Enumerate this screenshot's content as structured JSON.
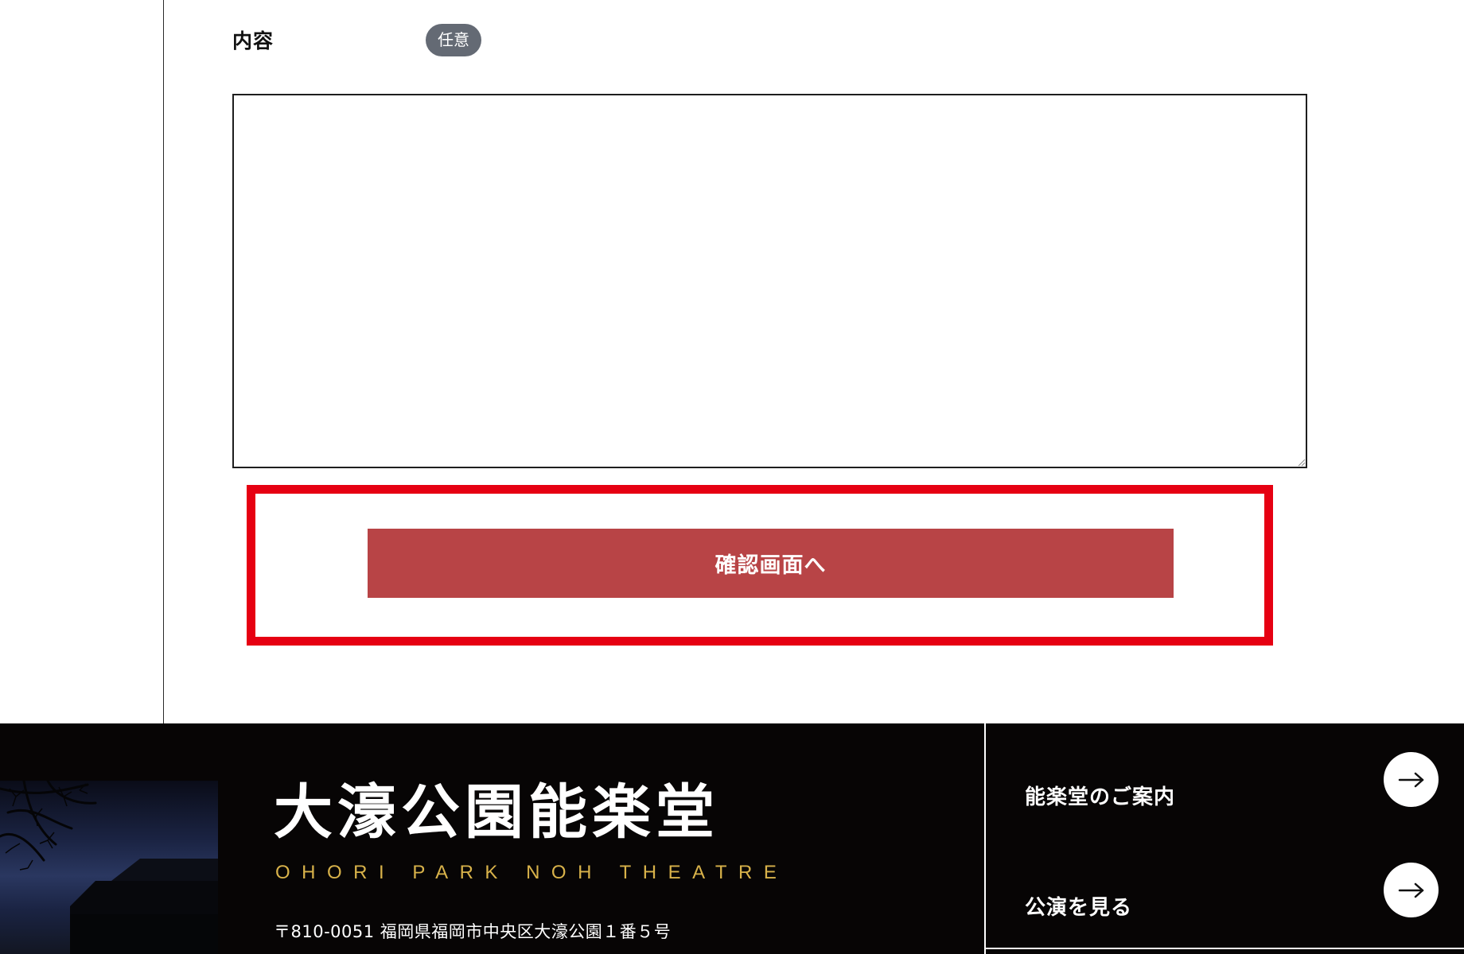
{
  "form": {
    "content_label": "内容",
    "optional_badge": "任意",
    "content_value": "",
    "submit_label": "確認画面へ"
  },
  "footer": {
    "logo_jp": "大濠公園能楽堂",
    "logo_en": "OHORI PARK NOH THEATRE",
    "address": "〒810-0051 福岡県福岡市中央区大濠公園１番５号",
    "nav": [
      {
        "label": "能楽堂のご案内",
        "icon": "arrow-right-icon"
      },
      {
        "label": "公演を見る",
        "icon": "arrow-right-icon"
      }
    ]
  },
  "colors": {
    "submit_button": "#b84446",
    "highlight": "#e60012",
    "badge": "#646a74",
    "footer_bg": "#070505",
    "logo_en": "#d8b24a"
  }
}
